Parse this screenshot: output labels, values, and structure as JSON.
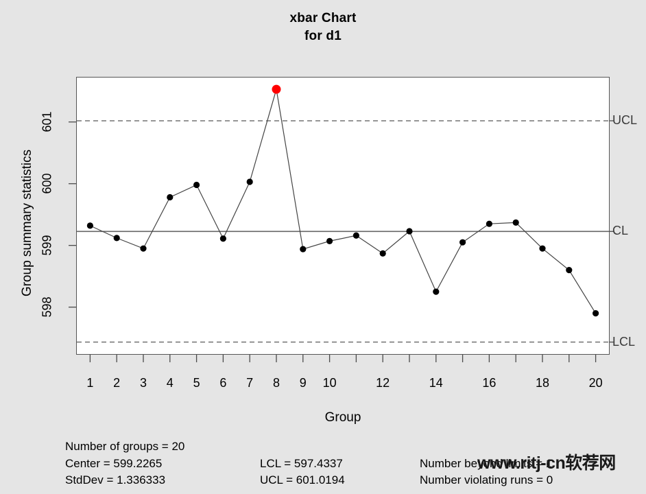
{
  "chart_data": {
    "type": "line",
    "title": "xbar Chart",
    "subtitle": "for d1",
    "xlabel": "Group",
    "ylabel": "Group summary statistics",
    "x": [
      1,
      2,
      3,
      4,
      5,
      6,
      7,
      8,
      9,
      10,
      11,
      12,
      13,
      14,
      15,
      16,
      17,
      18,
      19,
      20
    ],
    "categories": [
      "1",
      "2",
      "3",
      "4",
      "5",
      "6",
      "7",
      "8",
      "9",
      "10",
      "11",
      "12",
      "13",
      "14",
      "15",
      "16",
      "17",
      "18",
      "19",
      "20"
    ],
    "values": [
      599.32,
      599.12,
      598.95,
      599.78,
      599.98,
      599.11,
      600.03,
      601.53,
      598.94,
      599.07,
      599.16,
      598.87,
      599.23,
      598.25,
      599.05,
      599.35,
      599.37,
      598.95,
      598.6,
      597.9
    ],
    "point_colors": [
      "#000000",
      "#000000",
      "#000000",
      "#000000",
      "#000000",
      "#000000",
      "#000000",
      "#FF0000",
      "#000000",
      "#000000",
      "#000000",
      "#000000",
      "#000000",
      "#000000",
      "#000000",
      "#000000",
      "#000000",
      "#000000",
      "#000000",
      "#000000"
    ],
    "xtick_labels": [
      "1",
      "2",
      "3",
      "4",
      "5",
      "6",
      "7",
      "8",
      "9",
      "10",
      "",
      "12",
      "",
      "14",
      "",
      "16",
      "",
      "18",
      "",
      "20"
    ],
    "ytick_values": [
      598,
      599,
      600,
      601
    ],
    "ytick_labels": [
      "598",
      "599",
      "600",
      "601"
    ],
    "ylim": [
      597.24,
      601.72
    ],
    "xlim": [
      0.5,
      20.5
    ],
    "grid": false,
    "legend": "none",
    "reference_lines": [
      {
        "name": "UCL",
        "label": "UCL",
        "value": 601.0194,
        "style": "dashed"
      },
      {
        "name": "CL",
        "label": "CL",
        "value": 599.2265,
        "style": "solid"
      },
      {
        "name": "LCL",
        "label": "LCL",
        "value": 597.4337,
        "style": "dashed"
      }
    ],
    "colors": {
      "line": "#444444",
      "point": "#000000",
      "violation_point": "#FF0000",
      "limit_line": "#666666",
      "panel_background": "#FFFFFF",
      "figure_background": "#E5E5E5"
    }
  },
  "limit_labels": {
    "ucl": "UCL",
    "cl": "CL",
    "lcl": "LCL"
  },
  "footer": {
    "col1": {
      "line1": "Number of groups = 20",
      "line2": "Center = 599.2265",
      "line3": "StdDev = 1.336333"
    },
    "col2": {
      "line1": "LCL = 597.4337",
      "line2": "UCL = 601.0194"
    },
    "col3": {
      "line1": "Number beyond limits = 1",
      "line2": "Number violating runs = 0"
    }
  },
  "watermark": {
    "text": "www.ritj-cn软荐网"
  }
}
